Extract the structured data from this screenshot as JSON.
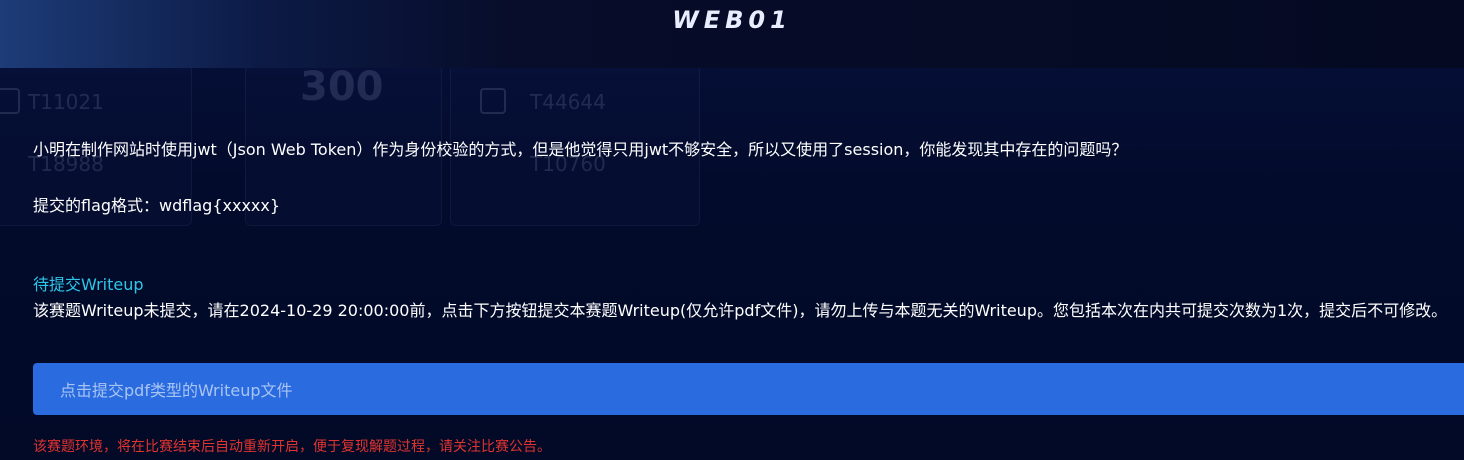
{
  "header": {
    "title": "WEB01"
  },
  "background_board": {
    "team_1": "T11021",
    "team_2": "T18988",
    "score": "300",
    "team_3": "T44644",
    "team_4": "T10760"
  },
  "challenge": {
    "description": "小明在制作网站时使用jwt（Json Web Token）作为身份校验的方式，但是他觉得只用jwt不够安全，所以又使用了session，你能发现其中存在的问题吗？",
    "flag_format": "提交的flag格式：wdflag{xxxxx}"
  },
  "writeup": {
    "section_title": "待提交Writeup",
    "notice": "该赛题Writeup未提交，请在2024-10-29 20:00:00前，点击下方按钮提交本赛题Writeup(仅允许pdf文件)，请勿上传与本题无关的Writeup。您包括本次在内共可提交次数为1次，提交后不可修改。",
    "upload_button_label": "点击提交pdf类型的Writeup文件"
  },
  "environment_notice": "该赛题环境，将在比赛结束后自动重新开启，便于复现解题过程，请关注比赛公告。",
  "colors": {
    "background": "#020a2a",
    "section_title": "#2ec6e8",
    "upload_button": "#2a6ce0",
    "warning_text": "#e0342f"
  }
}
